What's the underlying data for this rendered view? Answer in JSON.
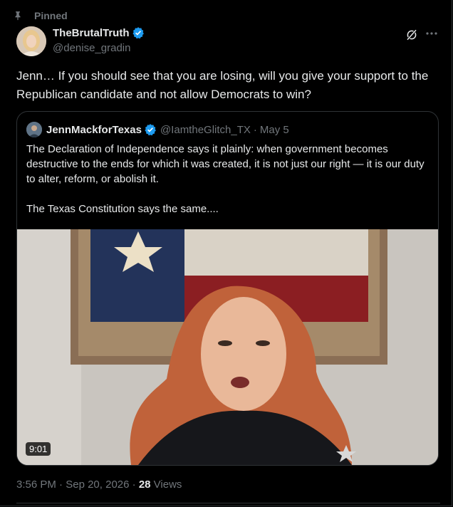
{
  "pinned": {
    "label": "Pinned",
    "icon": "pin-icon"
  },
  "author": {
    "display_name": "TheBrutalTruth",
    "handle": "@denise_gradin",
    "verified": true
  },
  "tweet": {
    "text": "Jenn… If you should see that you are losing, will you give your support to the Republican candidate and not allow Democrats to win?",
    "time": "3:56 PM",
    "date": "Sep 20, 2026",
    "views_count": "28",
    "views_label": "Views"
  },
  "quote": {
    "display_name": "JennMackforTexas",
    "handle": "@IamtheGlitch_TX",
    "date": "May 5",
    "verified": true,
    "paragraph_1": "The Declaration of Independence says it plainly: when government becomes destructive to the ends for which it was created, it is not just our right — it is our duty to alter, reform, or abolish it.",
    "paragraph_2": "The Texas Constitution says the same....",
    "video_duration": "9:01"
  },
  "colors": {
    "background": "#000000",
    "text_primary": "#e7e9ea",
    "text_secondary": "#71767b",
    "border": "#2f3336",
    "verified_blue": "#1d9bf0"
  },
  "icons": [
    "pin-icon",
    "verified-badge-icon",
    "grok-icon",
    "more-options-icon"
  ]
}
